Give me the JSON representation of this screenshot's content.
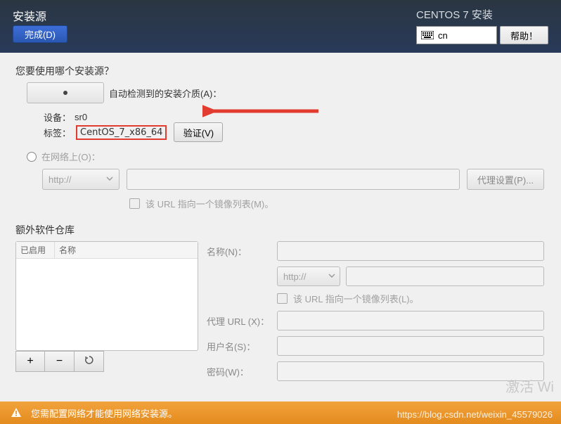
{
  "header": {
    "title": "安装源",
    "done": "完成(D)",
    "subtitle": "CENTOS 7 安装",
    "lang": "cn",
    "help": "帮助！"
  },
  "main": {
    "question": "您要使用哪个安装源？",
    "auto_label": "自动检测到的安装介质(A)：",
    "device_k": "设备：",
    "device_v": "sr0",
    "label_k": "标签：",
    "label_v": "CentOS_7_x86_64",
    "verify": "验证(V)",
    "net_label": "在网络上(O)：",
    "proto": "http://",
    "proxy_btn": "代理设置(P)...",
    "mirror_hint": "该 URL 指向一个镜像列表(M)。"
  },
  "repos": {
    "title": "额外软件仓库",
    "col_enabled": "已启用",
    "col_name": "名称",
    "add": "+",
    "remove": "−",
    "reload": "↻",
    "name_l": "名称(N)：",
    "proto": "http://",
    "mirror_l": "该 URL 指向一个镜像列表(L)。",
    "proxy_l": "代理 URL (X)：",
    "user_l": "用户名(S)：",
    "pass_l": "密码(W)："
  },
  "footer": {
    "warn": "您需配置网络才能使用网络安装源。",
    "url": "https://blog.csdn.net/weixin_45579026"
  },
  "watermark": "激活 Wi"
}
